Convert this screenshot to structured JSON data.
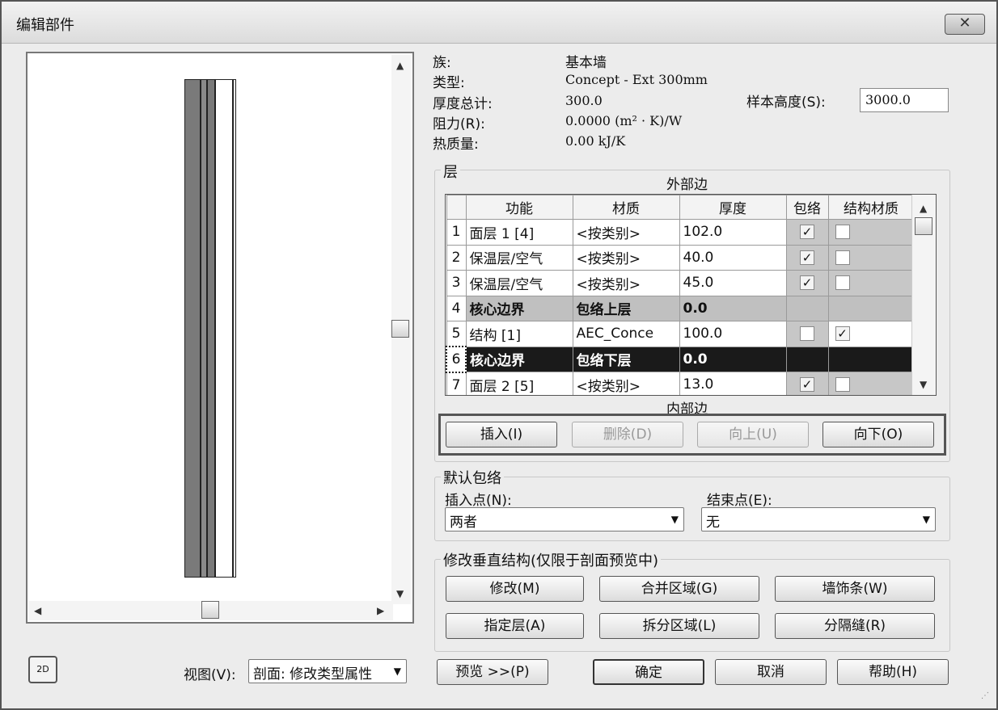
{
  "window": {
    "title": "编辑部件",
    "close_icon": "✕"
  },
  "info": {
    "family_label": "族:",
    "family_value": "基本墙",
    "type_label": "类型:",
    "type_value": "Concept - Ext 300mm",
    "thickness_label": "厚度总计:",
    "thickness_value": "300.0",
    "resistance_label": "阻力(R):",
    "resistance_value": "0.0000 (m² · K)/W",
    "thermal_label": "热质量:",
    "thermal_value": "0.00 kJ/K",
    "sample_height_label": "样本高度(S):",
    "sample_height_value": "3000.0"
  },
  "layers": {
    "group_label": "层",
    "exterior_label": "外部边",
    "interior_label": "内部边",
    "columns": [
      "功能",
      "材质",
      "厚度",
      "包络",
      "结构材质"
    ],
    "rows": [
      {
        "num": "1",
        "function": "面层 1 [4]",
        "material": "<按类别>",
        "thickness": "102.0",
        "wrap": true,
        "structural": false
      },
      {
        "num": "2",
        "function": "保温层/空气",
        "material": "<按类别>",
        "thickness": "40.0",
        "wrap": true,
        "structural": false
      },
      {
        "num": "3",
        "function": "保温层/空气",
        "material": "<按类别>",
        "thickness": "45.0",
        "wrap": true,
        "structural": false
      },
      {
        "num": "4",
        "function": "核心边界",
        "material": "包络上层",
        "thickness": "0.0"
      },
      {
        "num": "5",
        "function": "结构 [1]",
        "material": "AEC_Conce",
        "thickness": "100.0",
        "wrap": false,
        "structural": true
      },
      {
        "num": "6",
        "function": "核心边界",
        "material": "包络下层",
        "thickness": "0.0"
      },
      {
        "num": "7",
        "function": "面层 2 [5]",
        "material": "<按类别>",
        "thickness": "13.0",
        "wrap": true,
        "structural": false
      }
    ],
    "buttons": {
      "insert": "插入(I)",
      "delete": "删除(D)",
      "up": "向上(U)",
      "down": "向下(O)"
    }
  },
  "default_wrap": {
    "group_label": "默认包络",
    "insert_label": "插入点(N):",
    "insert_value": "两者",
    "end_label": "结束点(E):",
    "end_value": "无"
  },
  "vertical": {
    "group_label": "修改垂直结构(仅限于剖面预览中)",
    "modify": "修改(M)",
    "merge": "合并区域(G)",
    "sweep": "墙饰条(W)",
    "assign": "指定层(A)",
    "split": "拆分区域(L)",
    "reveal": "分隔缝(R)"
  },
  "footer": {
    "view_label": "视图(V):",
    "view_value": "剖面: 修改类型属性",
    "preview": "预览 >>(P)",
    "ok": "确定",
    "cancel": "取消",
    "help": "帮助(H)"
  },
  "icon_2d": "2D",
  "colors": {
    "wall_dark": "#7a7a7a",
    "wall_mid": "#9a9a9a",
    "selected_row": "#1a1a1a",
    "core_row": "#c0c0c0"
  }
}
